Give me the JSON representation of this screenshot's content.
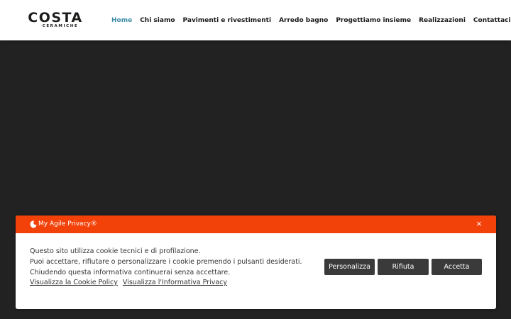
{
  "header": {
    "logo": {
      "name": "COSTA",
      "tagline": "CERAMICHE"
    },
    "nav": [
      {
        "label": "Home",
        "active": true
      },
      {
        "label": "Chi siamo",
        "active": false
      },
      {
        "label": "Pavimenti e rivestimenti",
        "active": false
      },
      {
        "label": "Arredo bagno",
        "active": false
      },
      {
        "label": "Progettiamo insieme",
        "active": false
      },
      {
        "label": "Realizzazioni",
        "active": false
      },
      {
        "label": "Contattaci",
        "active": false
      }
    ],
    "search_icon": "search-icon"
  },
  "cookie_banner": {
    "brand": "My Agile Privacy®",
    "close_label": "×",
    "text_lines": [
      "Questo sito utilizza cookie tecnici e di profilazione.",
      "Puoi accettare, rifiutare o personalizzare i cookie premendo i pulsanti desiderati.",
      "Chiudendo questa informativa continuerai senza accettare."
    ],
    "links": [
      "Visualizza la Cookie Policy",
      "Visualizza l'Informativa Privacy"
    ],
    "buttons": {
      "customize": "Personalizza",
      "reject": "Rifiuta",
      "accept": "Accetta"
    }
  },
  "colors": {
    "accent": "#3f8ea8",
    "banner_bar": "#f2420a",
    "button": "#3a3a3a",
    "hero_background": "#222222"
  }
}
